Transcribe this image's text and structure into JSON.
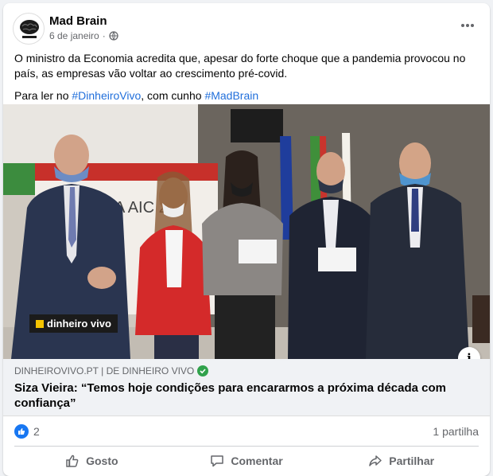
{
  "post": {
    "author": "Mad Brain",
    "date": "6 de janeiro",
    "separator": "·",
    "more_icon": "more-horizontal-icon",
    "paragraph1": "O ministro da Economia acredita que, apesar do forte choque que a pandemia provocou no país, as empresas vão voltar ao crescimento pré-covid.",
    "paragraph2_prefix": "Para ler no ",
    "hashtag1": "#DinheiroVivo",
    "paragraph2_middle": ", com cunho ",
    "hashtag2": "#MadBrain"
  },
  "photo": {
    "watermark": "dinheiro vivo",
    "backdrop_text": "A AIC   20",
    "info_label": "i"
  },
  "link": {
    "domain": "DINHEIROVIVO.PT | DE DINHEIRO VIVO",
    "headline": "Siza Vieira: “Temos hoje condições para encararmos a próxima década com confiança”"
  },
  "stats": {
    "likes": "2",
    "shares": "1 partilha"
  },
  "actions": {
    "like": "Gosto",
    "comment": "Comentar",
    "share": "Partilhar"
  },
  "colors": {
    "accent": "#1877f2",
    "hashtag": "#216fdb",
    "verified": "#31a24c"
  }
}
